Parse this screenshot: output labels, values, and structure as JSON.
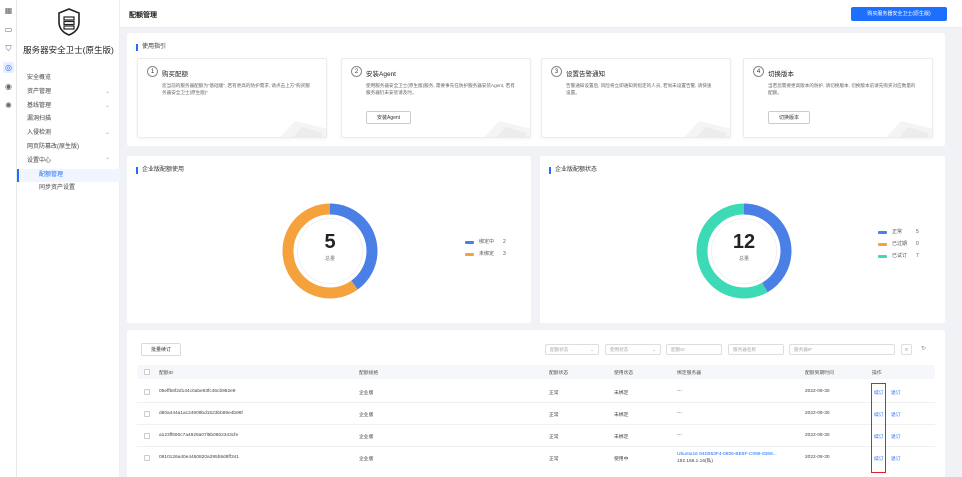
{
  "app": {
    "brand": "服务器安全卫士(原生版)",
    "rail_icons": [
      "grid-icon",
      "window-icon",
      "shield-icon",
      "target-icon",
      "lock-icon",
      "cog-shield-icon"
    ]
  },
  "sidebar": {
    "items": [
      {
        "label": "安全概览",
        "arrow": ""
      },
      {
        "label": "资产管理",
        "arrow": "⌄"
      },
      {
        "label": "基线管理",
        "arrow": "⌄"
      },
      {
        "label": "漏洞扫描",
        "arrow": ""
      },
      {
        "label": "入侵检测",
        "arrow": "⌄"
      },
      {
        "label": "网页防篡改(原生版)",
        "arrow": ""
      },
      {
        "label": "设置中心",
        "arrow": "⌃"
      }
    ],
    "sub_items": [
      {
        "label": "配额管理",
        "active": true
      },
      {
        "label": "同步资产设置",
        "active": false
      }
    ]
  },
  "header": {
    "title": "配额管理",
    "buy_button": "购买服务器安全卫士(原生版)"
  },
  "guide": {
    "title": "使用指引",
    "steps": [
      {
        "num": "1",
        "title": "购买配额",
        "desc": "您当前的服务器配额为\"基础版\", 若有更高的防护需求, 请点击上方\"购买服务器安全卫士(原生版)\"",
        "button": ""
      },
      {
        "num": "2",
        "title": "安装Agent",
        "desc": "使用服务器安全卫士(原生版)服务, 需要事先在防护服务器安装Agent, 若有服务器仍未安装请及时。",
        "button": "安装Agent"
      },
      {
        "num": "3",
        "title": "设置告警通知",
        "desc": "告警通知设置后, 风险将立即通知到指定的人员, 若尚未设置告警, 请快速设置。",
        "button": ""
      },
      {
        "num": "4",
        "title": "切换版本",
        "desc": "当若您需要更高版本的防护, 请切换版本, 切换版本前请先购买对应数量的配额。",
        "button": "切换版本"
      }
    ]
  },
  "usage": {
    "title": "企业版配额使用",
    "total": "5",
    "total_label": "总量",
    "legend": [
      {
        "name": "绑定中",
        "value": "2",
        "color": "#4a7fe6"
      },
      {
        "name": "未绑定",
        "value": "3",
        "color": "#f5a13c"
      }
    ]
  },
  "status": {
    "title": "企业版配额状态",
    "total": "12",
    "total_label": "总量",
    "legend": [
      {
        "name": "正常",
        "value": "5",
        "color": "#4a7fe6"
      },
      {
        "name": "已过期",
        "value": "0",
        "color": "#f5a13c"
      },
      {
        "name": "已试订",
        "value": "7",
        "color": "#3ddbb5"
      }
    ]
  },
  "chart_data": [
    {
      "type": "pie",
      "title": "企业版配额使用",
      "categories": [
        "绑定中",
        "未绑定"
      ],
      "values": [
        2,
        3
      ]
    },
    {
      "type": "pie",
      "title": "企业版配额状态",
      "categories": [
        "正常",
        "已过期",
        "已试订"
      ],
      "values": [
        5,
        0,
        7
      ]
    }
  ],
  "table": {
    "batch_button": "批量续订",
    "filters": {
      "quota_status": "配额状态",
      "use_status": "使用状态",
      "quota_id": "配额ID",
      "server_name": "服务器名称",
      "server_ip": "服务器IP"
    },
    "columns": [
      "配额ID",
      "配额规格",
      "配额状态",
      "使用状态",
      "绑定服务器",
      "配额到期时间",
      "操作"
    ],
    "rows": [
      {
        "id": "05effb6f2d144c0abe93fc45cb982e9",
        "spec": "企业版",
        "status": "正常",
        "use": "未绑定",
        "server": "---",
        "server_ip": "",
        "expire": "2022-09-30",
        "op1": "续订",
        "op2": "退订"
      },
      {
        "id": "d80a444a1ac24909bd1523bb89e4b96f",
        "spec": "企业版",
        "status": "正常",
        "use": "未绑定",
        "server": "---",
        "server_ip": "",
        "expire": "2022-09-30",
        "op1": "续订",
        "op2": "退订"
      },
      {
        "id": "a123ff690c7a4929a07l5b0662343cfe",
        "spec": "企业版",
        "status": "正常",
        "use": "未绑定",
        "server": "---",
        "server_ip": "",
        "expire": "2022-09-30",
        "op1": "续订",
        "op2": "退订"
      },
      {
        "id": "0810126a40e4460820a295b9d8ff341",
        "spec": "企业版",
        "status": "正常",
        "use": "使用中",
        "server": "Ubuntu16 94D953F4-0805-BE6F-C096-8368...",
        "server_ip": "192.168.1.16(私)",
        "expire": "2022-09-30",
        "op1": "续订",
        "op2": "退订"
      }
    ]
  }
}
